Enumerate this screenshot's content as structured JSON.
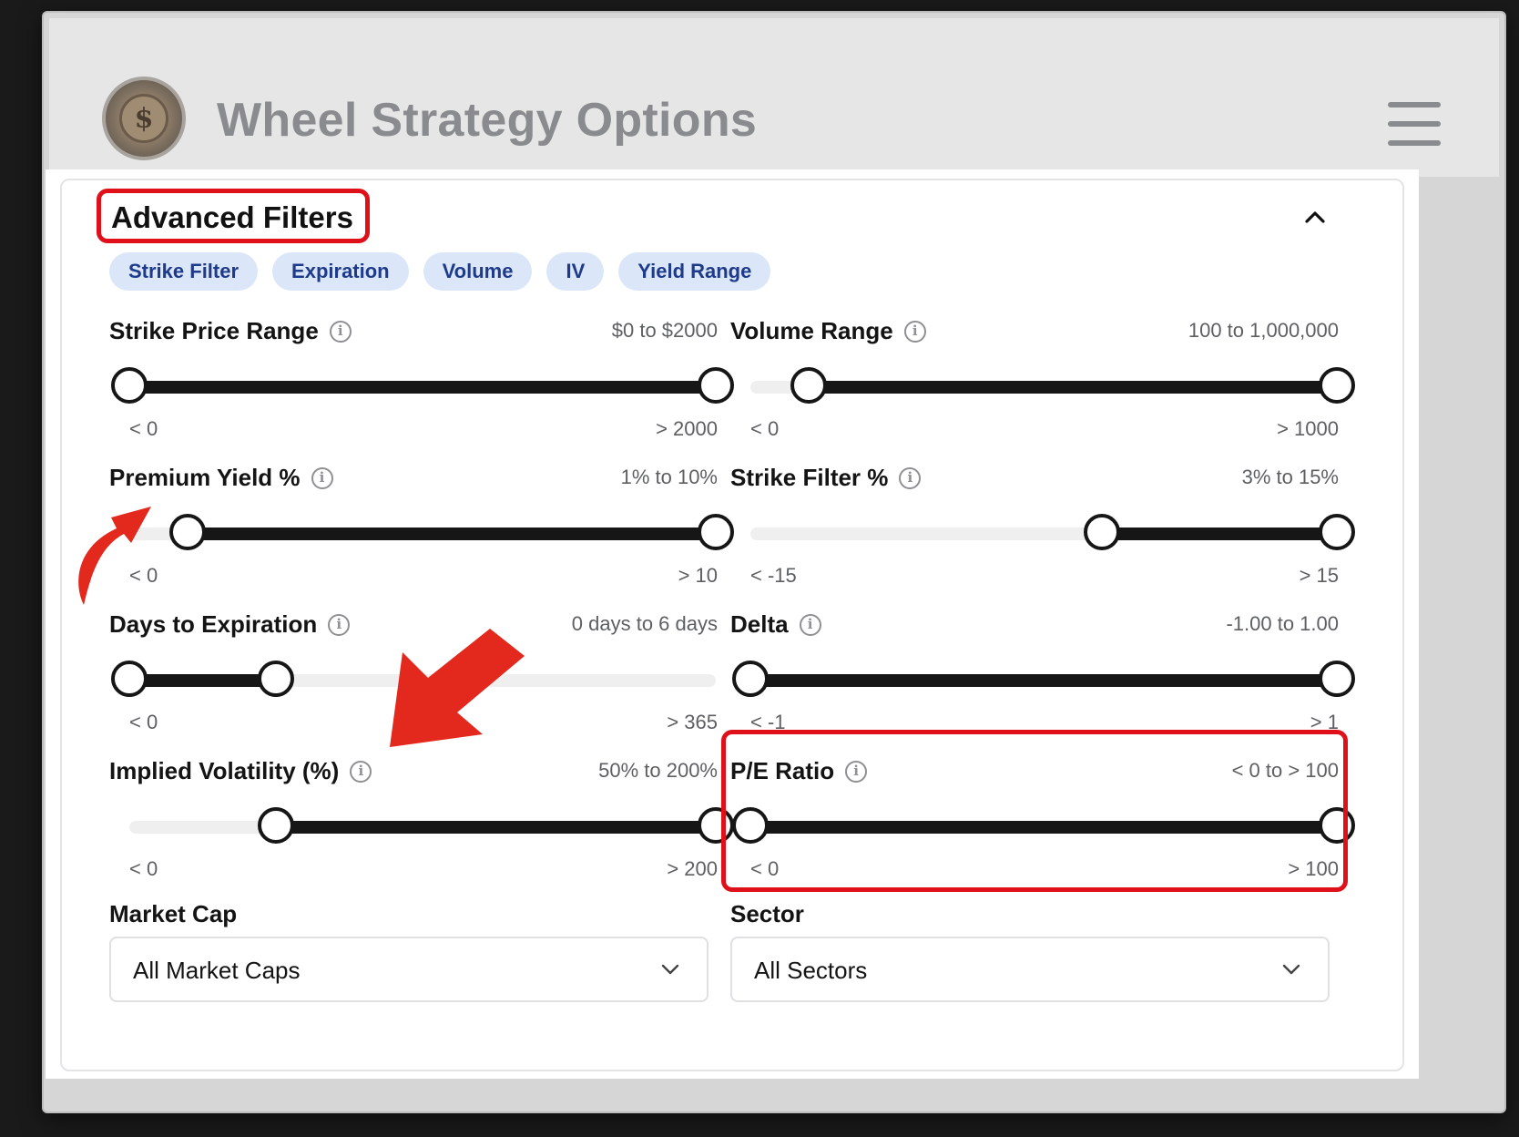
{
  "app": {
    "title": "Wheel Strategy Options",
    "logo_symbol": "$"
  },
  "panel": {
    "title": "Advanced Filters",
    "chips": [
      "Strike Filter",
      "Expiration",
      "Volume",
      "IV",
      "Yield Range"
    ]
  },
  "filters": {
    "strike_price": {
      "label": "Strike Price Range",
      "value": "$0 to $2000",
      "min_label": "< 0",
      "max_label": "> 2000",
      "low": 0,
      "high": 1
    },
    "volume": {
      "label": "Volume Range",
      "value": "100 to 1,000,000",
      "min_label": "< 0",
      "max_label": "> 1000",
      "low": 0.1,
      "high": 1
    },
    "premium_yield": {
      "label": "Premium Yield %",
      "value": "1% to 10%",
      "min_label": "< 0",
      "max_label": "> 10",
      "low": 0.1,
      "high": 1
    },
    "strike_filter": {
      "label": "Strike Filter %",
      "value": "3% to 15%",
      "min_label": "< -15",
      "max_label": "> 15",
      "low": 0.6,
      "high": 1
    },
    "days_to_expiration": {
      "label": "Days to Expiration",
      "value": "0 days to 6 days",
      "min_label": "< 0",
      "max_label": "> 365",
      "low": 0,
      "high": 0.25
    },
    "delta": {
      "label": "Delta",
      "value": "-1.00 to 1.00",
      "min_label": "< -1",
      "max_label": "> 1",
      "low": 0,
      "high": 1
    },
    "implied_volatility": {
      "label": "Implied Volatility (%)",
      "value": "50% to 200%",
      "min_label": "< 0",
      "max_label": "> 200",
      "low": 0.25,
      "high": 1
    },
    "pe_ratio": {
      "label": "P/E Ratio",
      "value": "< 0 to > 100",
      "min_label": "< 0",
      "max_label": "> 100",
      "low": 0,
      "high": 1
    }
  },
  "market_cap": {
    "label": "Market Cap",
    "selected": "All Market Caps"
  },
  "sector": {
    "label": "Sector",
    "selected": "All Sectors"
  },
  "colors": {
    "highlight": "#e0101a",
    "chip_bg": "#dbe7f8",
    "chip_text": "#1e3a8a",
    "arrow": "#e3291d"
  }
}
